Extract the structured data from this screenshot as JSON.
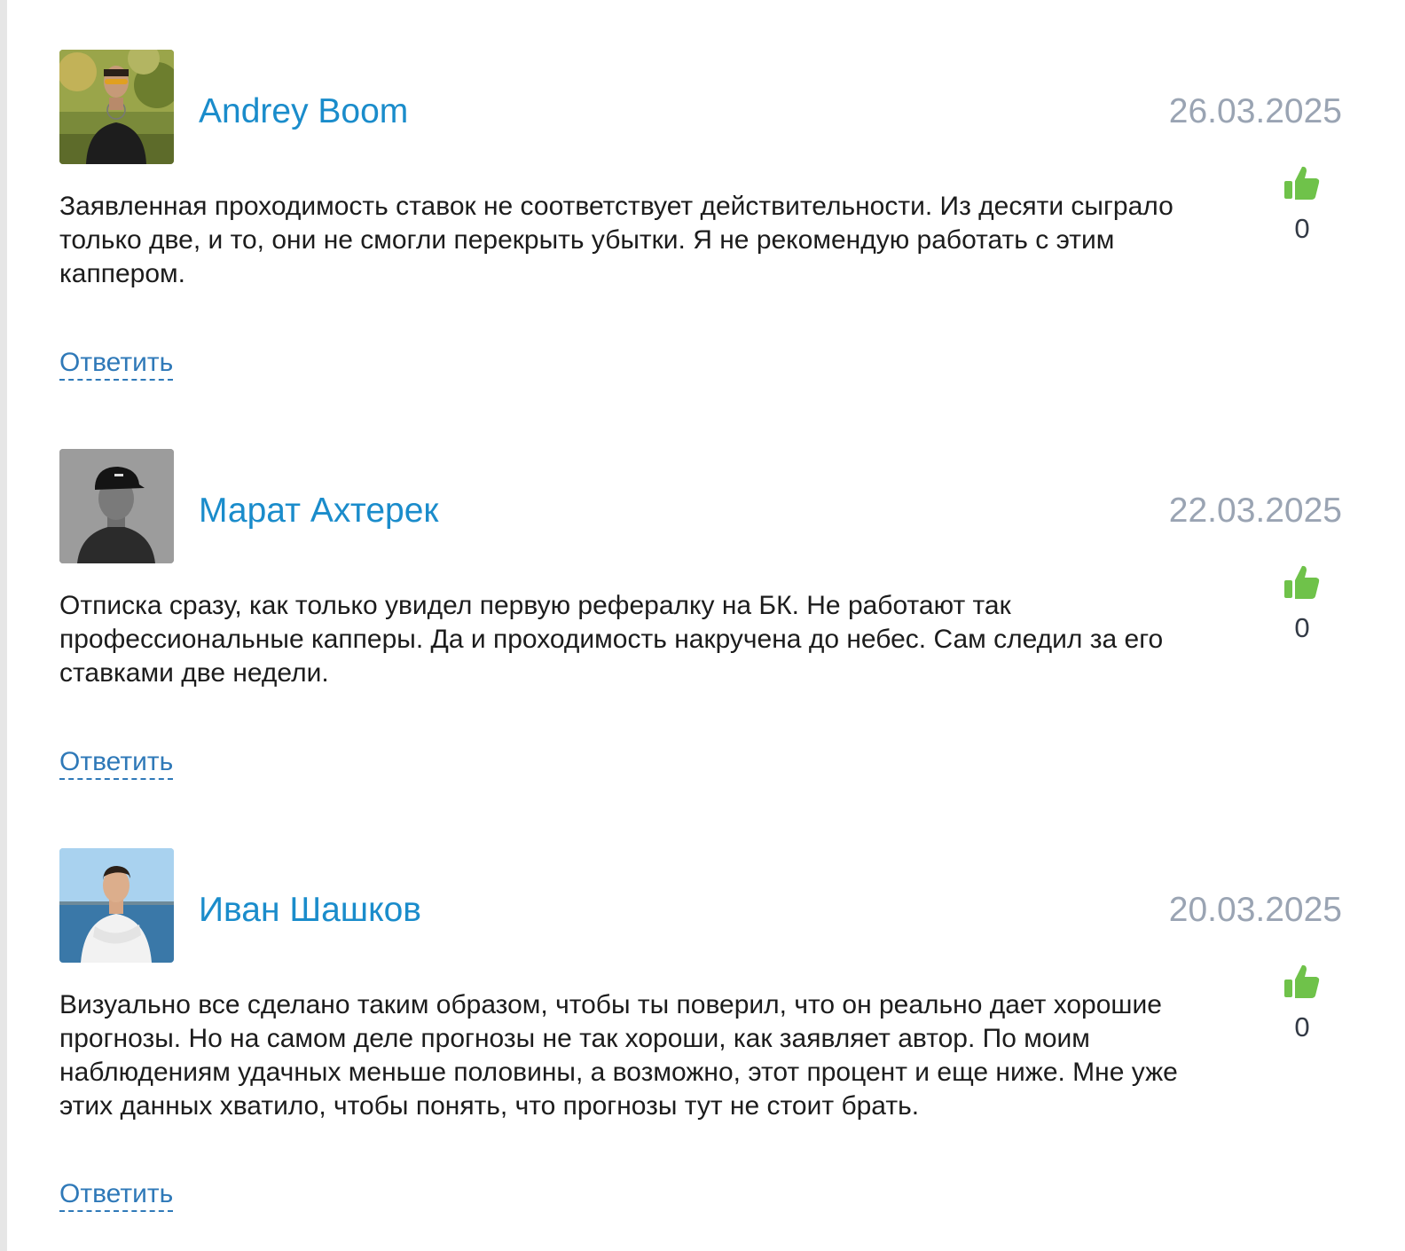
{
  "comments": [
    {
      "author": "Andrey Boom",
      "date": "26.03.2025",
      "likes": "0",
      "text": "Заявленная проходимость ставок не соответствует действительности. Из десяти сыграло только две, и то, они не смогли перекрыть убытки. Я не рекомендую работать с этим каппером.",
      "reply_label": "Ответить",
      "avatar_icon": "avatar-photo-man-sunglasses"
    },
    {
      "author": "Марат Ахтерек",
      "date": "22.03.2025",
      "likes": "0",
      "text": "Отписка сразу, как только увидел первую рефералку на БК. Не работают так профессиональные капперы. Да и проходимость накручена до небес. Сам следил за его ставками две недели.",
      "reply_label": "Ответить",
      "avatar_icon": "avatar-photo-man-cap"
    },
    {
      "author": "Иван Шашков",
      "date": "20.03.2025",
      "likes": "0",
      "text": "Визуально все сделано таким образом, чтобы ты поверил, что он реально дает хорошие прогнозы. Но на самом деле прогнозы не так хороши, как заявляет автор. По моим наблюдениям удачных меньше половины, а возможно, этот процент и еще ниже. Мне уже этих данных хватило, чтобы понять, что прогнозы тут не стоит брать.",
      "reply_label": "Ответить",
      "avatar_icon": "avatar-photo-man-sea"
    }
  ],
  "colors": {
    "author": "#1a8ccb",
    "date": "#9aa4b3",
    "like_icon": "#6fc24a",
    "reply": "#2f79b8"
  },
  "icons": {
    "like": "thumbs-up-icon"
  }
}
